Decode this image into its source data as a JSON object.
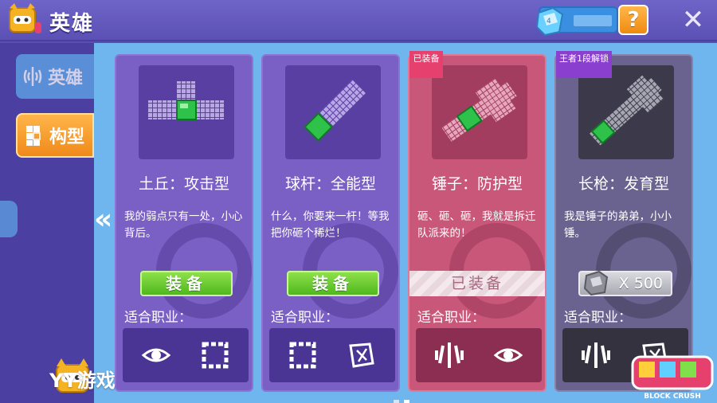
{
  "header": {
    "title": "英雄",
    "help_label": "?",
    "close_label": "✕"
  },
  "sidenav": {
    "tabs": [
      {
        "label": "英雄",
        "icon": "hero-icon"
      },
      {
        "label": "构型",
        "icon": "shape-icon"
      }
    ]
  },
  "cards": [
    {
      "title": "土丘：攻击型",
      "desc": "我的弱点只有一处，小心背后。",
      "button": "装备",
      "suit_label": "适合职业：",
      "classes": [
        "eye-icon",
        "square-frame-icon"
      ]
    },
    {
      "title": "球杆：全能型",
      "desc": "什么，你要来一杆！等我把你砸个稀烂！",
      "button": "装备",
      "suit_label": "适合职业：",
      "classes": [
        "square-frame-icon",
        "shattered-block-icon"
      ]
    },
    {
      "title": "锤子：防护型",
      "desc": "砸、砸、砸，我就是拆迁队派来的！",
      "button": "已装备",
      "ribbon": "已装备",
      "suit_label": "适合职业：",
      "classes": [
        "shield-icon",
        "eye-icon"
      ]
    },
    {
      "title": "长枪：发育型",
      "desc": "我是锤子的弟弟，小小锤。",
      "price": "X 500",
      "ribbon": "王者1段解锁",
      "suit_label": "适合职业：",
      "classes": [
        "shield-icon",
        "shattered-block-icon"
      ]
    }
  ],
  "footer": {
    "brand_text": "YY游戏",
    "game_logo_text": "BLOCK CRUSH"
  },
  "colors": {
    "accent_orange": "#f08a12",
    "equip_green": "#4fb81e",
    "equipped_pink": "#c9577a",
    "background_purple": "#5a4fb0"
  }
}
